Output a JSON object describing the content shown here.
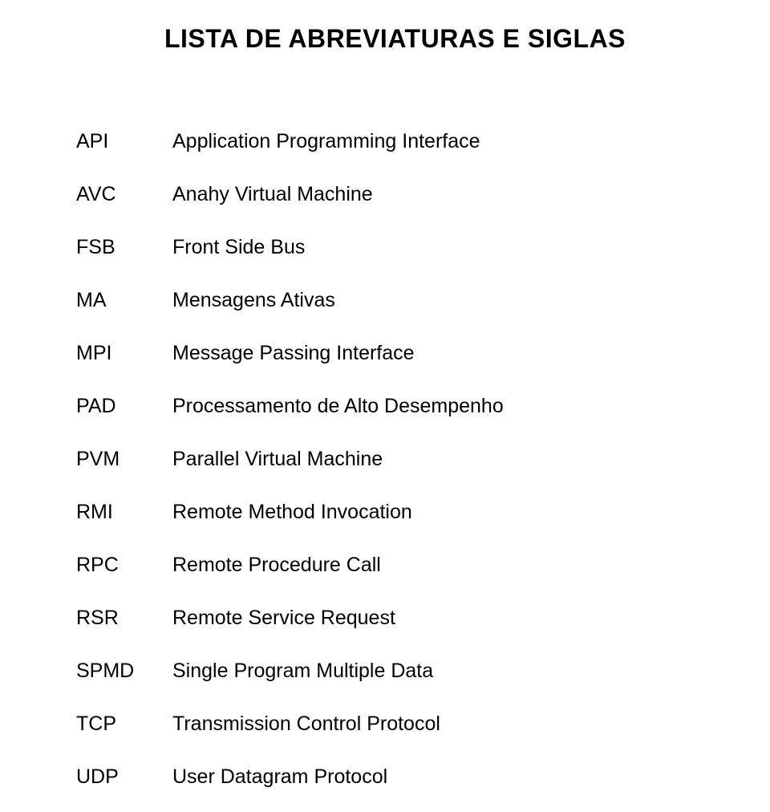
{
  "title": "LISTA DE ABREVIATURAS E SIGLAS",
  "items": [
    {
      "term": "API",
      "definition": "Application Programming Interface"
    },
    {
      "term": "AVC",
      "definition": "Anahy Virtual Machine"
    },
    {
      "term": "FSB",
      "definition": "Front Side Bus"
    },
    {
      "term": "MA",
      "definition": "Mensagens Ativas"
    },
    {
      "term": "MPI",
      "definition": "Message Passing Interface"
    },
    {
      "term": "PAD",
      "definition": "Processamento de Alto Desempenho"
    },
    {
      "term": "PVM",
      "definition": "Parallel Virtual Machine"
    },
    {
      "term": "RMI",
      "definition": "Remote Method Invocation"
    },
    {
      "term": "RPC",
      "definition": "Remote Procedure Call"
    },
    {
      "term": "RSR",
      "definition": "Remote Service Request"
    },
    {
      "term": "SPMD",
      "definition": "Single Program Multiple Data"
    },
    {
      "term": "TCP",
      "definition": "Transmission Control Protocol"
    },
    {
      "term": "UDP",
      "definition": "User Datagram Protocol"
    }
  ]
}
